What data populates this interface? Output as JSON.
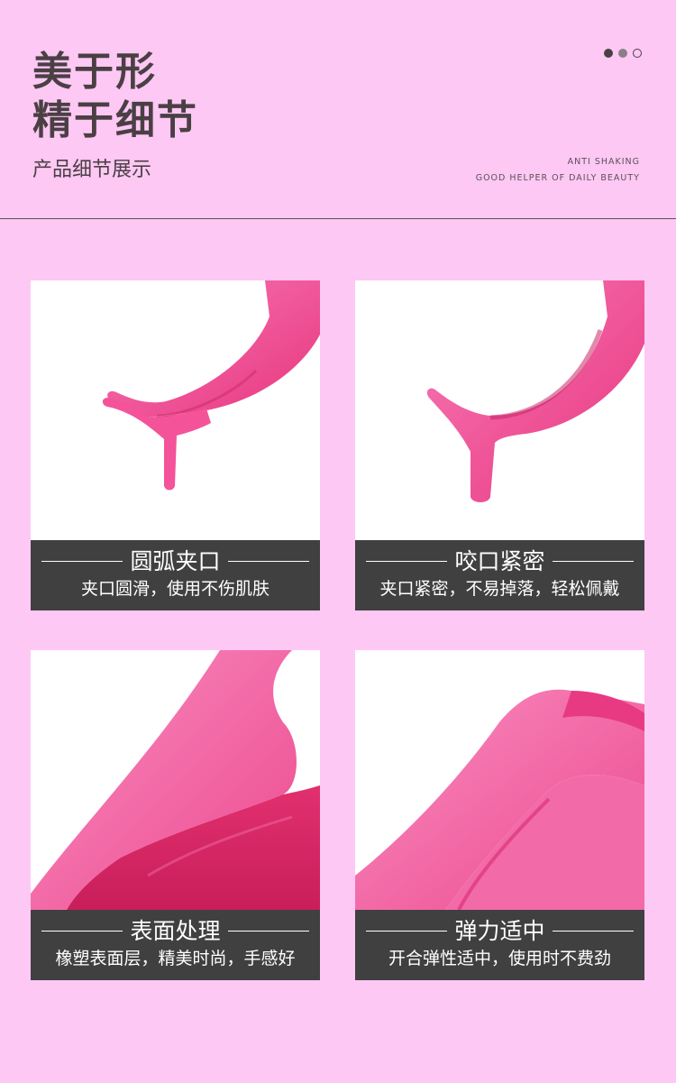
{
  "header": {
    "title_line1": "美于形",
    "title_line2": "精于细节",
    "subtitle": "产品细节展示",
    "english_line1": "ANTI SHAKING",
    "english_line2": "GOOD HELPER OF DAILY BEAUTY"
  },
  "colors": {
    "background": "#fdc8f4",
    "product_pink": "#f4539a",
    "caption_bar": "#404040"
  },
  "cards": [
    {
      "title": "圆弧夹口",
      "desc": "夹口圆滑，使用不伤肌肤"
    },
    {
      "title": "咬口紧密",
      "desc": "夹口紧密，不易掉落，轻松佩戴"
    },
    {
      "title": "表面处理",
      "desc": "橡塑表面层，精美时尚，手感好"
    },
    {
      "title": "弹力适中",
      "desc": "开合弹性适中，使用时不费劲"
    }
  ]
}
